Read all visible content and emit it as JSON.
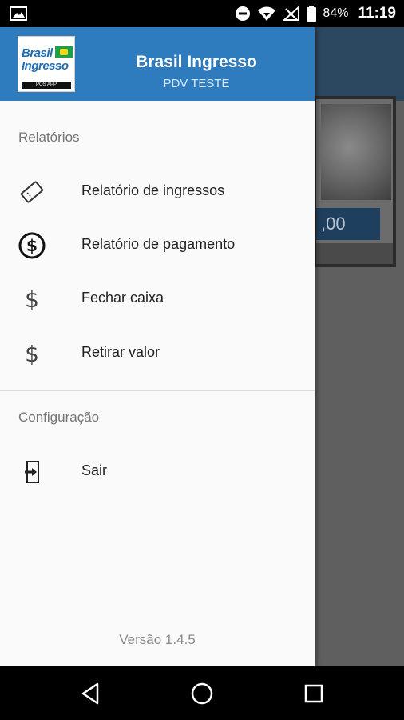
{
  "status_bar": {
    "battery": "84%",
    "time": "11:19"
  },
  "background": {
    "card_price": ",00"
  },
  "drawer": {
    "header": {
      "logo_line1": "Brasil",
      "logo_line2": "Ingresso",
      "logo_sub": "POS APP",
      "title": "Brasil Ingresso",
      "subtitle": "PDV TESTE"
    },
    "sections": [
      {
        "label": "Relatórios",
        "items": [
          {
            "label": "Relatório de ingressos",
            "icon": "ticket-icon"
          },
          {
            "label": "Relatório de pagamento",
            "icon": "dollar-circle-icon"
          },
          {
            "label": "Fechar caixa",
            "icon": "dollar-icon"
          },
          {
            "label": "Retirar valor",
            "icon": "dollar-icon"
          }
        ]
      },
      {
        "label": "Configuração",
        "items": [
          {
            "label": "Sair",
            "icon": "exit-icon"
          }
        ]
      }
    ],
    "version": "Versão 1.4.5"
  },
  "colors": {
    "header": "#2e7bbd",
    "drawer_bg": "#fafafa",
    "text": "#212121",
    "section_text": "#757575"
  }
}
